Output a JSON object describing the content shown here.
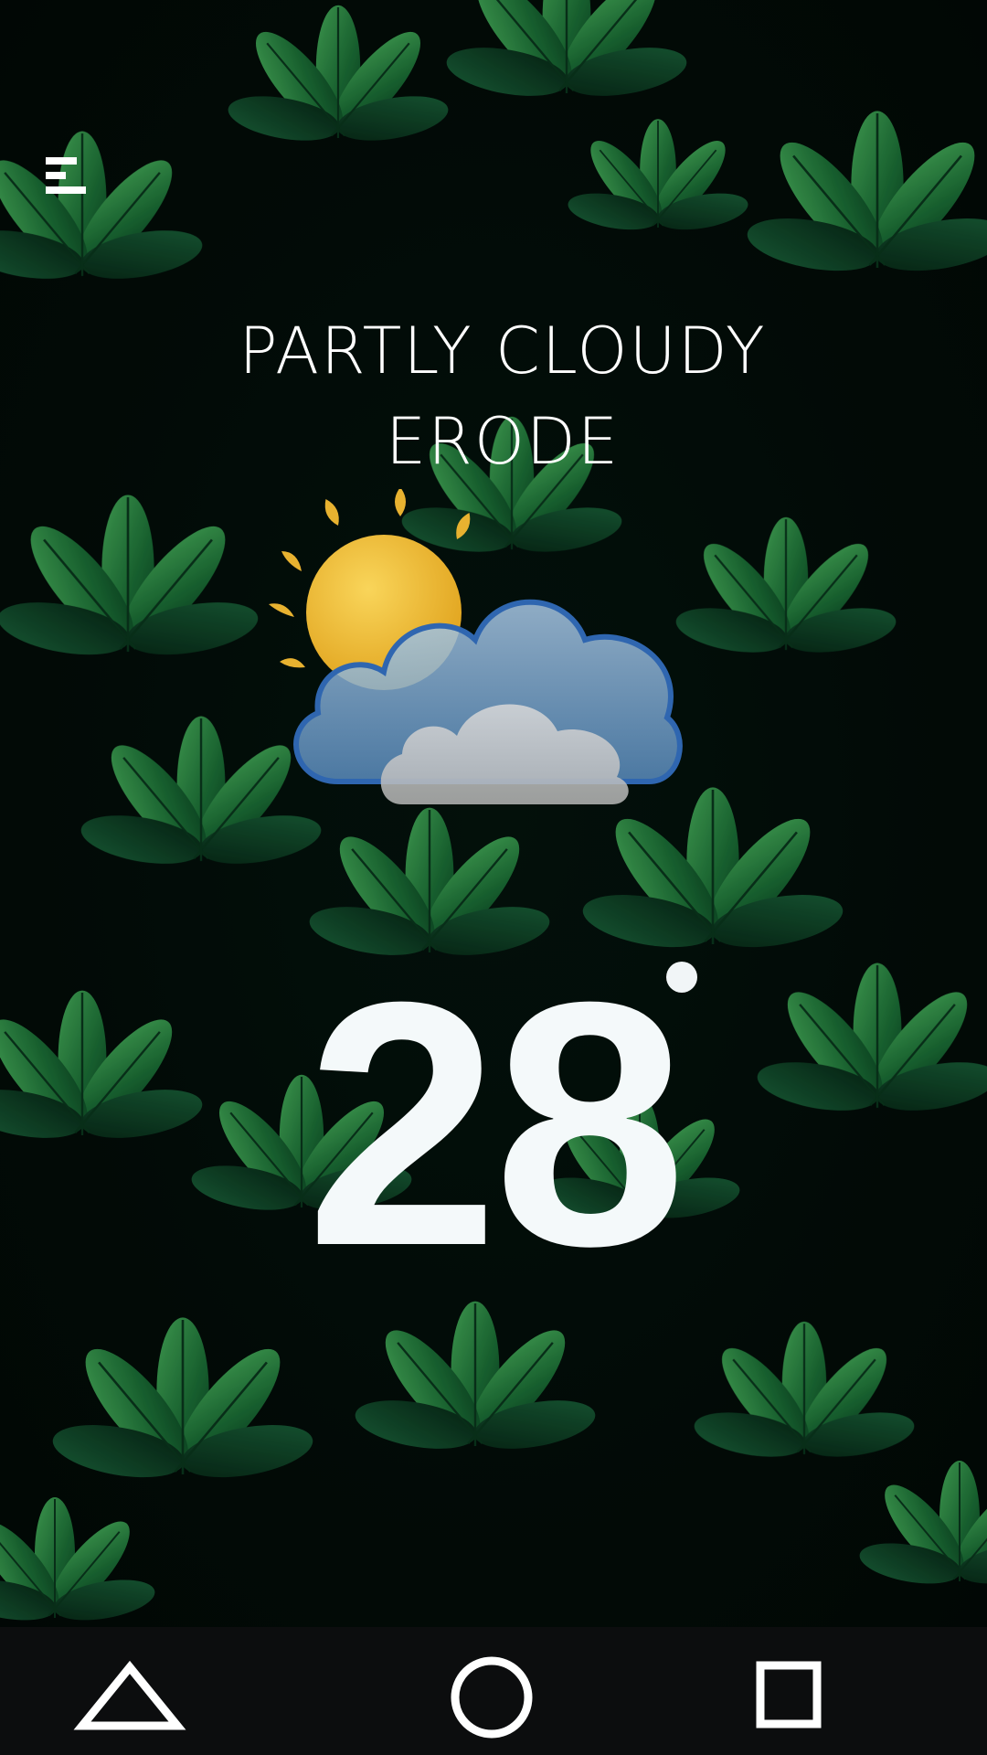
{
  "weather": {
    "condition": "PARTLY CLOUDY",
    "city": "ERODE",
    "temperature": "28",
    "icon": "partly-cloudy-icon"
  },
  "header": {
    "menu_icon": "hamburger-menu-icon"
  },
  "navbar": {
    "back_icon": "triangle-back-icon",
    "home_icon": "circle-home-icon",
    "recents_icon": "square-recents-icon"
  },
  "colors": {
    "text": "#ffffff",
    "sun": "#f0b72a",
    "cloud_blue": "#5c97d2",
    "cloud_gray": "#c9c9c9",
    "navbar": "#0c0d0e"
  }
}
